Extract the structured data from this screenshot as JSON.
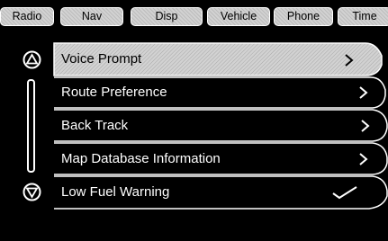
{
  "tabs": [
    {
      "label": "Radio"
    },
    {
      "label": "Nav"
    },
    {
      "label": "Disp"
    },
    {
      "label": "Vehicle"
    },
    {
      "label": "Phone"
    },
    {
      "label": "Time"
    }
  ],
  "menu": {
    "items": [
      {
        "label": "Voice Prompt",
        "indicator": "chevron-right-icon",
        "selected": true
      },
      {
        "label": "Route Preference",
        "indicator": "chevron-right-icon",
        "selected": false
      },
      {
        "label": "Back Track",
        "indicator": "chevron-right-icon",
        "selected": false
      },
      {
        "label": "Map Database Information",
        "indicator": "chevron-right-icon",
        "selected": false
      },
      {
        "label": "Low Fuel Warning",
        "indicator": "checkmark-icon",
        "checked": true,
        "selected": false
      }
    ]
  },
  "colors": {
    "background": "#000000",
    "text": "#ffffff",
    "selected_fill": "#d2d2d2",
    "outline": "#ffffff"
  }
}
